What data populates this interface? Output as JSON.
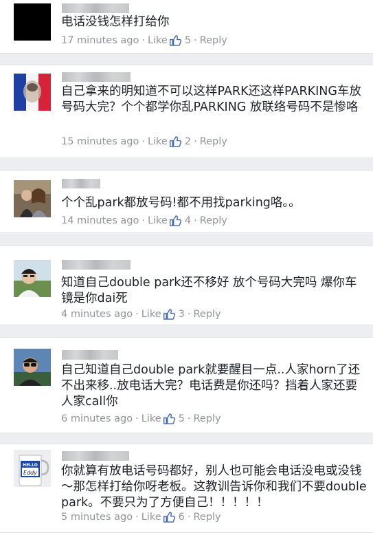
{
  "comments": [
    {
      "text": "电话没钱怎样打给你",
      "time": "17 minutes ago",
      "like": "Like",
      "count": "5",
      "reply": "Reply",
      "avatar": "black-avatar"
    },
    {
      "text": "自己拿来的明知道不可以这样PARK还这样PARKING车放号码大完？个个都学你乱PARKING 放联络号码不是惨咯",
      "time": "15 minutes ago",
      "like": "Like",
      "count": "2",
      "reply": "Reply",
      "avatar": "flag-avatar"
    },
    {
      "text": "个个乱park都放号码!都不用找parking咯。。",
      "time": "14 minutes ago",
      "like": "Like",
      "count": "4",
      "reply": "Reply",
      "avatar": "couple-photo-avatar"
    },
    {
      "text": "知道自己double park还不移好 放个号码大完吗 爆你车镜是你dai死",
      "time": "4 minutes ago",
      "like": "Like",
      "count": "3",
      "reply": "Reply",
      "avatar": "man-photo-avatar"
    },
    {
      "text": "自己知道自己double park就要醒目一点..人家horn了还不出来移..放电话大完？电话费是你还吗？挡着人家还要人家call你",
      "time": "6 minutes ago",
      "like": "Like",
      "count": "5",
      "reply": "Reply",
      "avatar": "sunglasses-man-avatar"
    },
    {
      "text": "你就算有放电话号码都好，别人也可能会电话没电或没钱～那怎样打给你呀老板。这教训告诉你和我们不要double park。不要只为了方便自己！！！！！",
      "time": "5 minutes ago",
      "like": "Like",
      "count": "6",
      "reply": "Reply",
      "avatar": "mug-avatar",
      "mug_label_top": "HELLO",
      "mug_label_name": "Eddy"
    }
  ],
  "colors": {
    "text": "#1d2129",
    "meta": "#90949c",
    "thumb": "#4267b2",
    "background": "#eceef2"
  },
  "icons": {
    "like_count": "thumbs-up-icon"
  }
}
